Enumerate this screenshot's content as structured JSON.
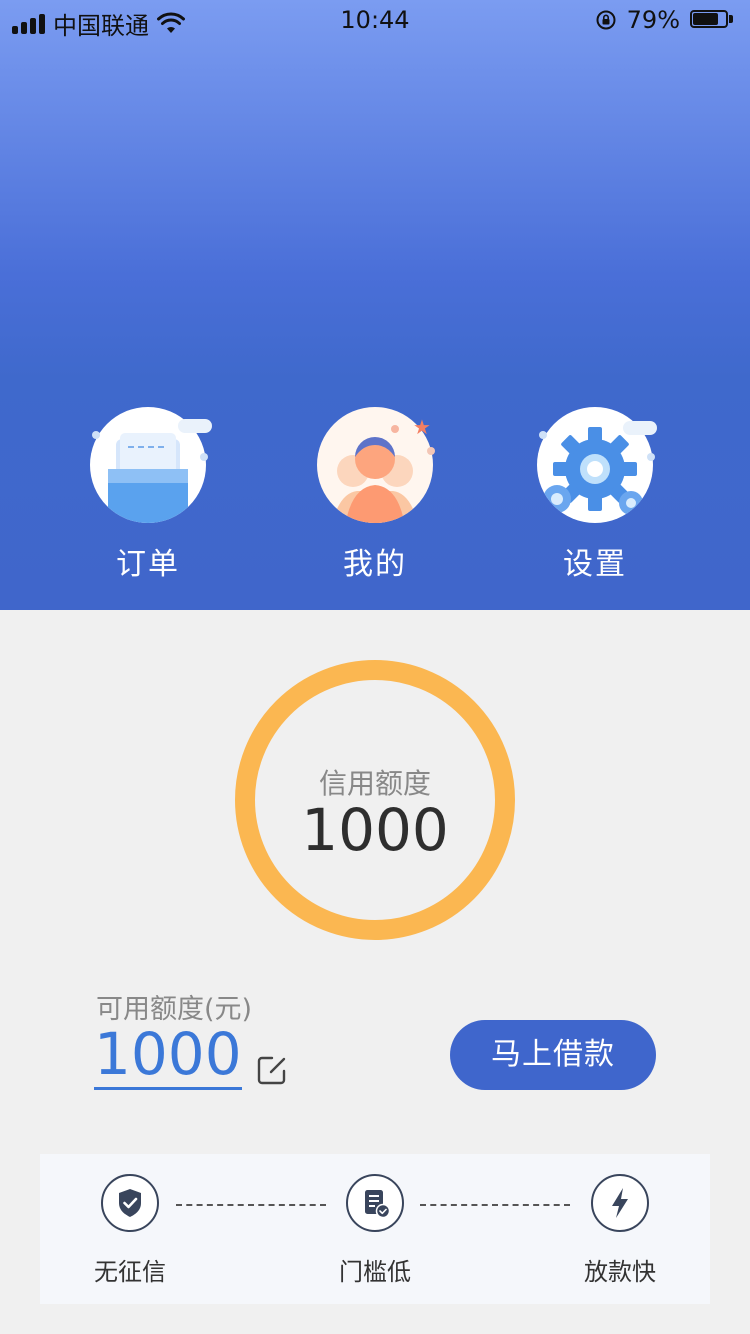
{
  "status_bar": {
    "carrier": "中国联通",
    "time": "10:44",
    "battery_percent": "79%",
    "battery_level": 0.79
  },
  "quick_menu": {
    "items": [
      {
        "label": "订单",
        "icon": "order-icon"
      },
      {
        "label": "我的",
        "icon": "profile-icon"
      },
      {
        "label": "设置",
        "icon": "settings-gear-icon"
      }
    ]
  },
  "credit": {
    "label": "信用额度",
    "value": "1000"
  },
  "available": {
    "label": "可用额度(元)",
    "value": "1000"
  },
  "actions": {
    "borrow_label": "马上借款"
  },
  "features": [
    {
      "label": "无征信",
      "icon": "shield-check-icon"
    },
    {
      "label": "门槛低",
      "icon": "document-check-icon"
    },
    {
      "label": "放款快",
      "icon": "lightning-icon"
    }
  ],
  "colors": {
    "header_blue": "#4066cb",
    "ring_orange": "#fbb751",
    "accent_blue": "#3b78d8",
    "button_blue": "#3f66cc"
  }
}
